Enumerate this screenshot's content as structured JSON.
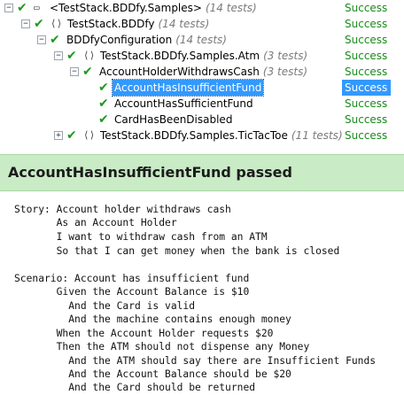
{
  "tree": {
    "rows": [
      {
        "name": "<TestStack.BDDfy.Samples>",
        "count": "(14 tests)",
        "result": "Success"
      },
      {
        "name": "TestStack.BDDfy",
        "count": "(14 tests)",
        "result": "Success"
      },
      {
        "name": "BDDfyConfiguration",
        "count": "(14 tests)",
        "result": "Success"
      },
      {
        "name": "TestStack.BDDfy.Samples.Atm",
        "count": "(3 tests)",
        "result": "Success"
      },
      {
        "name": "AccountHolderWithdrawsCash",
        "count": "(3 tests)",
        "result": "Success"
      },
      {
        "name": "AccountHasInsufficientFund",
        "count": "",
        "result": "Success"
      },
      {
        "name": "AccountHasSufficientFund",
        "count": "",
        "result": "Success"
      },
      {
        "name": "CardHasBeenDisabled",
        "count": "",
        "result": "Success"
      },
      {
        "name": "TestStack.BDDfy.Samples.TicTacToe",
        "count": "(11 tests)",
        "result": "Success"
      }
    ],
    "icons": {
      "expand": "⊟-icon",
      "collapse": "⊞-icon",
      "check": "✔",
      "assembly_glyph": "▭",
      "namespace_glyph": "⟨⟩"
    }
  },
  "details": {
    "title": "AccountHasInsufficientFund passed",
    "lines": [
      "Story: Account holder withdraws cash",
      "       As an Account Holder",
      "       I want to withdraw cash from an ATM",
      "       So that I can get money when the bank is closed",
      "",
      "Scenario: Account has insufficient fund",
      "       Given the Account Balance is $10",
      "         And the Card is valid",
      "         And the machine contains enough money",
      "       When the Account Holder requests $20",
      "       Then the ATM should not dispense any Money",
      "         And the ATM should say there are Insufficient Funds",
      "         And the Account Balance should be $20",
      "         And the Card should be returned"
    ]
  },
  "colors": {
    "success": "#1a8a1a",
    "selection": "#3399ff",
    "header_bg": "#c9ebc6"
  }
}
